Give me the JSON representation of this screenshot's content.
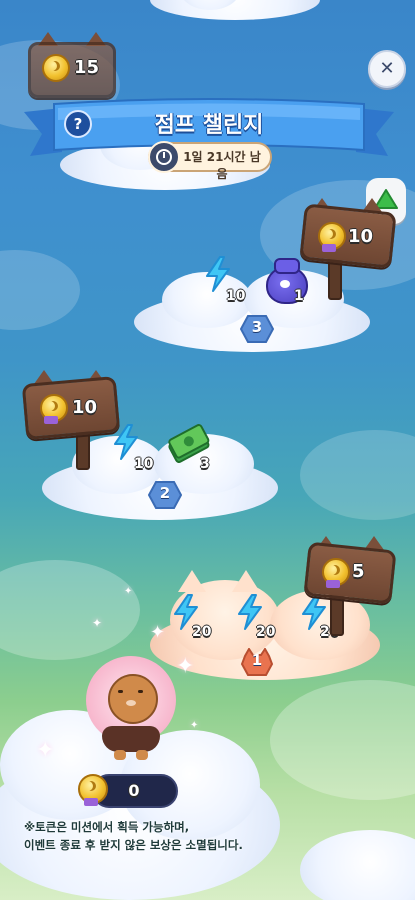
{
  "header": {
    "title": "점프 챌린지",
    "timer_text": "1일 21시간 남음",
    "help_symbol": "?",
    "close_symbol": "✕",
    "accent_color": "#3b8fe0"
  },
  "peek_sign_top": {
    "count": "15"
  },
  "levels": [
    {
      "level": "3",
      "rewards": [
        {
          "icon": "bolt-icon",
          "count": "10"
        },
        {
          "icon": "pouch-icon",
          "count": "1"
        }
      ],
      "sign_count": "10"
    },
    {
      "level": "2",
      "rewards": [
        {
          "icon": "bolt-icon",
          "count": "10"
        },
        {
          "icon": "cash-icon",
          "count": "3"
        }
      ],
      "sign_count": "10"
    },
    {
      "level": "1",
      "rewards": [
        {
          "icon": "bolt-icon",
          "count": "20"
        },
        {
          "icon": "bolt-icon",
          "count": "20"
        },
        {
          "icon": "bolt-icon",
          "count": "20"
        }
      ],
      "sign_count": "5"
    }
  ],
  "token_counter": {
    "value": "0"
  },
  "notice": {
    "line1": "※토큰은 미션에서 획득 가능하며,",
    "line2": "이벤트 종료 후 받지 않은 보상은 소멸됩니다."
  }
}
